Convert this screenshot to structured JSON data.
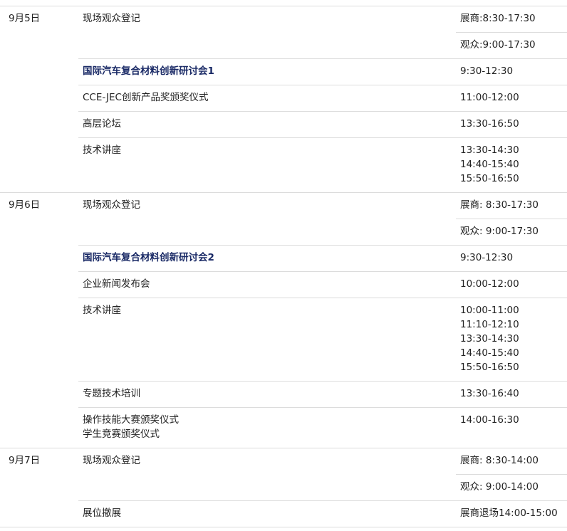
{
  "accent_color": "#1a2a66",
  "border_color": "#dcdcdc",
  "days": [
    {
      "date": "9月5日",
      "rows": [
        {
          "event": [
            "现场观众登记"
          ],
          "time": [
            "展商:8:30-17:30"
          ]
        },
        {
          "event": [],
          "time": [
            "观众:9:00-17:30"
          ]
        },
        {
          "event": [
            "国际汽车复合材料创新研讨会1"
          ],
          "bold": true,
          "time": [
            "9:30-12:30"
          ]
        },
        {
          "event": [
            "CCE-JEC创新产品奖颁奖仪式"
          ],
          "time": [
            "11:00-12:00"
          ]
        },
        {
          "event": [
            "高层论坛"
          ],
          "time": [
            "13:30-16:50"
          ]
        },
        {
          "event": [
            "技术讲座"
          ],
          "time": [
            "13:30-14:30",
            "14:40-15:40",
            "15:50-16:50"
          ]
        }
      ]
    },
    {
      "date": "9月6日",
      "rows": [
        {
          "event": [
            "现场观众登记"
          ],
          "time": [
            "展商: 8:30-17:30"
          ]
        },
        {
          "event": [],
          "time": [
            "观众: 9:00-17:30"
          ]
        },
        {
          "event": [
            "国际汽车复合材料创新研讨会2"
          ],
          "bold": true,
          "time": [
            "9:30-12:30"
          ]
        },
        {
          "event": [
            "企业新闻发布会"
          ],
          "time": [
            "10:00-12:00"
          ]
        },
        {
          "event": [
            "技术讲座"
          ],
          "time": [
            "10:00-11:00",
            "11:10-12:10",
            "13:30-14:30",
            "14:40-15:40",
            "15:50-16:50"
          ]
        },
        {
          "event": [
            "专题技术培训"
          ],
          "time": [
            "13:30-16:40"
          ]
        },
        {
          "event": [
            "操作技能大赛颁奖仪式",
            "学生竞赛颁奖仪式"
          ],
          "time": [
            "14:00-16:30"
          ]
        }
      ]
    },
    {
      "date": "9月7日",
      "rows": [
        {
          "event": [
            "现场观众登记"
          ],
          "time": [
            "展商: 8:30-14:00"
          ]
        },
        {
          "event": [],
          "time": [
            "观众: 9:00-14:00"
          ]
        },
        {
          "event": [
            "展位撤展"
          ],
          "time": [
            "展商退场14:00-15:00"
          ]
        }
      ]
    }
  ]
}
